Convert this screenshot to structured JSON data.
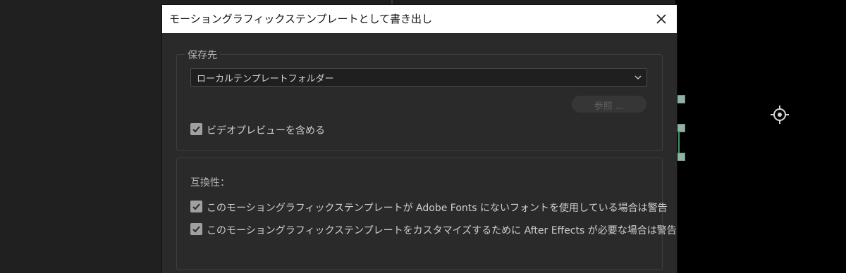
{
  "dialog": {
    "title": "モーショングラフィックステンプレートとして書き出し",
    "close_icon": "close-icon"
  },
  "destination": {
    "legend": "保存先",
    "selected": "ローカルテンプレートフォルダー",
    "browse_label": "参照 ...",
    "include_preview": {
      "label": "ビデオプレビューを含める",
      "checked": true
    }
  },
  "compatibility": {
    "label": "互換性：",
    "options": [
      {
        "label": "このモーショングラフィックステンプレートが Adobe Fonts にないフォントを使用している場合は警告",
        "checked": true
      },
      {
        "label": "このモーショングラフィックステンプレートをカスタマイズするために After Effects が必要な場合は警告",
        "checked": true
      }
    ]
  },
  "colors": {
    "dialog_bg": "#2a2a2a",
    "titlebar_bg": "#ffffff",
    "checkbox": "#a0a0a0",
    "handle": "#8fb3a2"
  }
}
